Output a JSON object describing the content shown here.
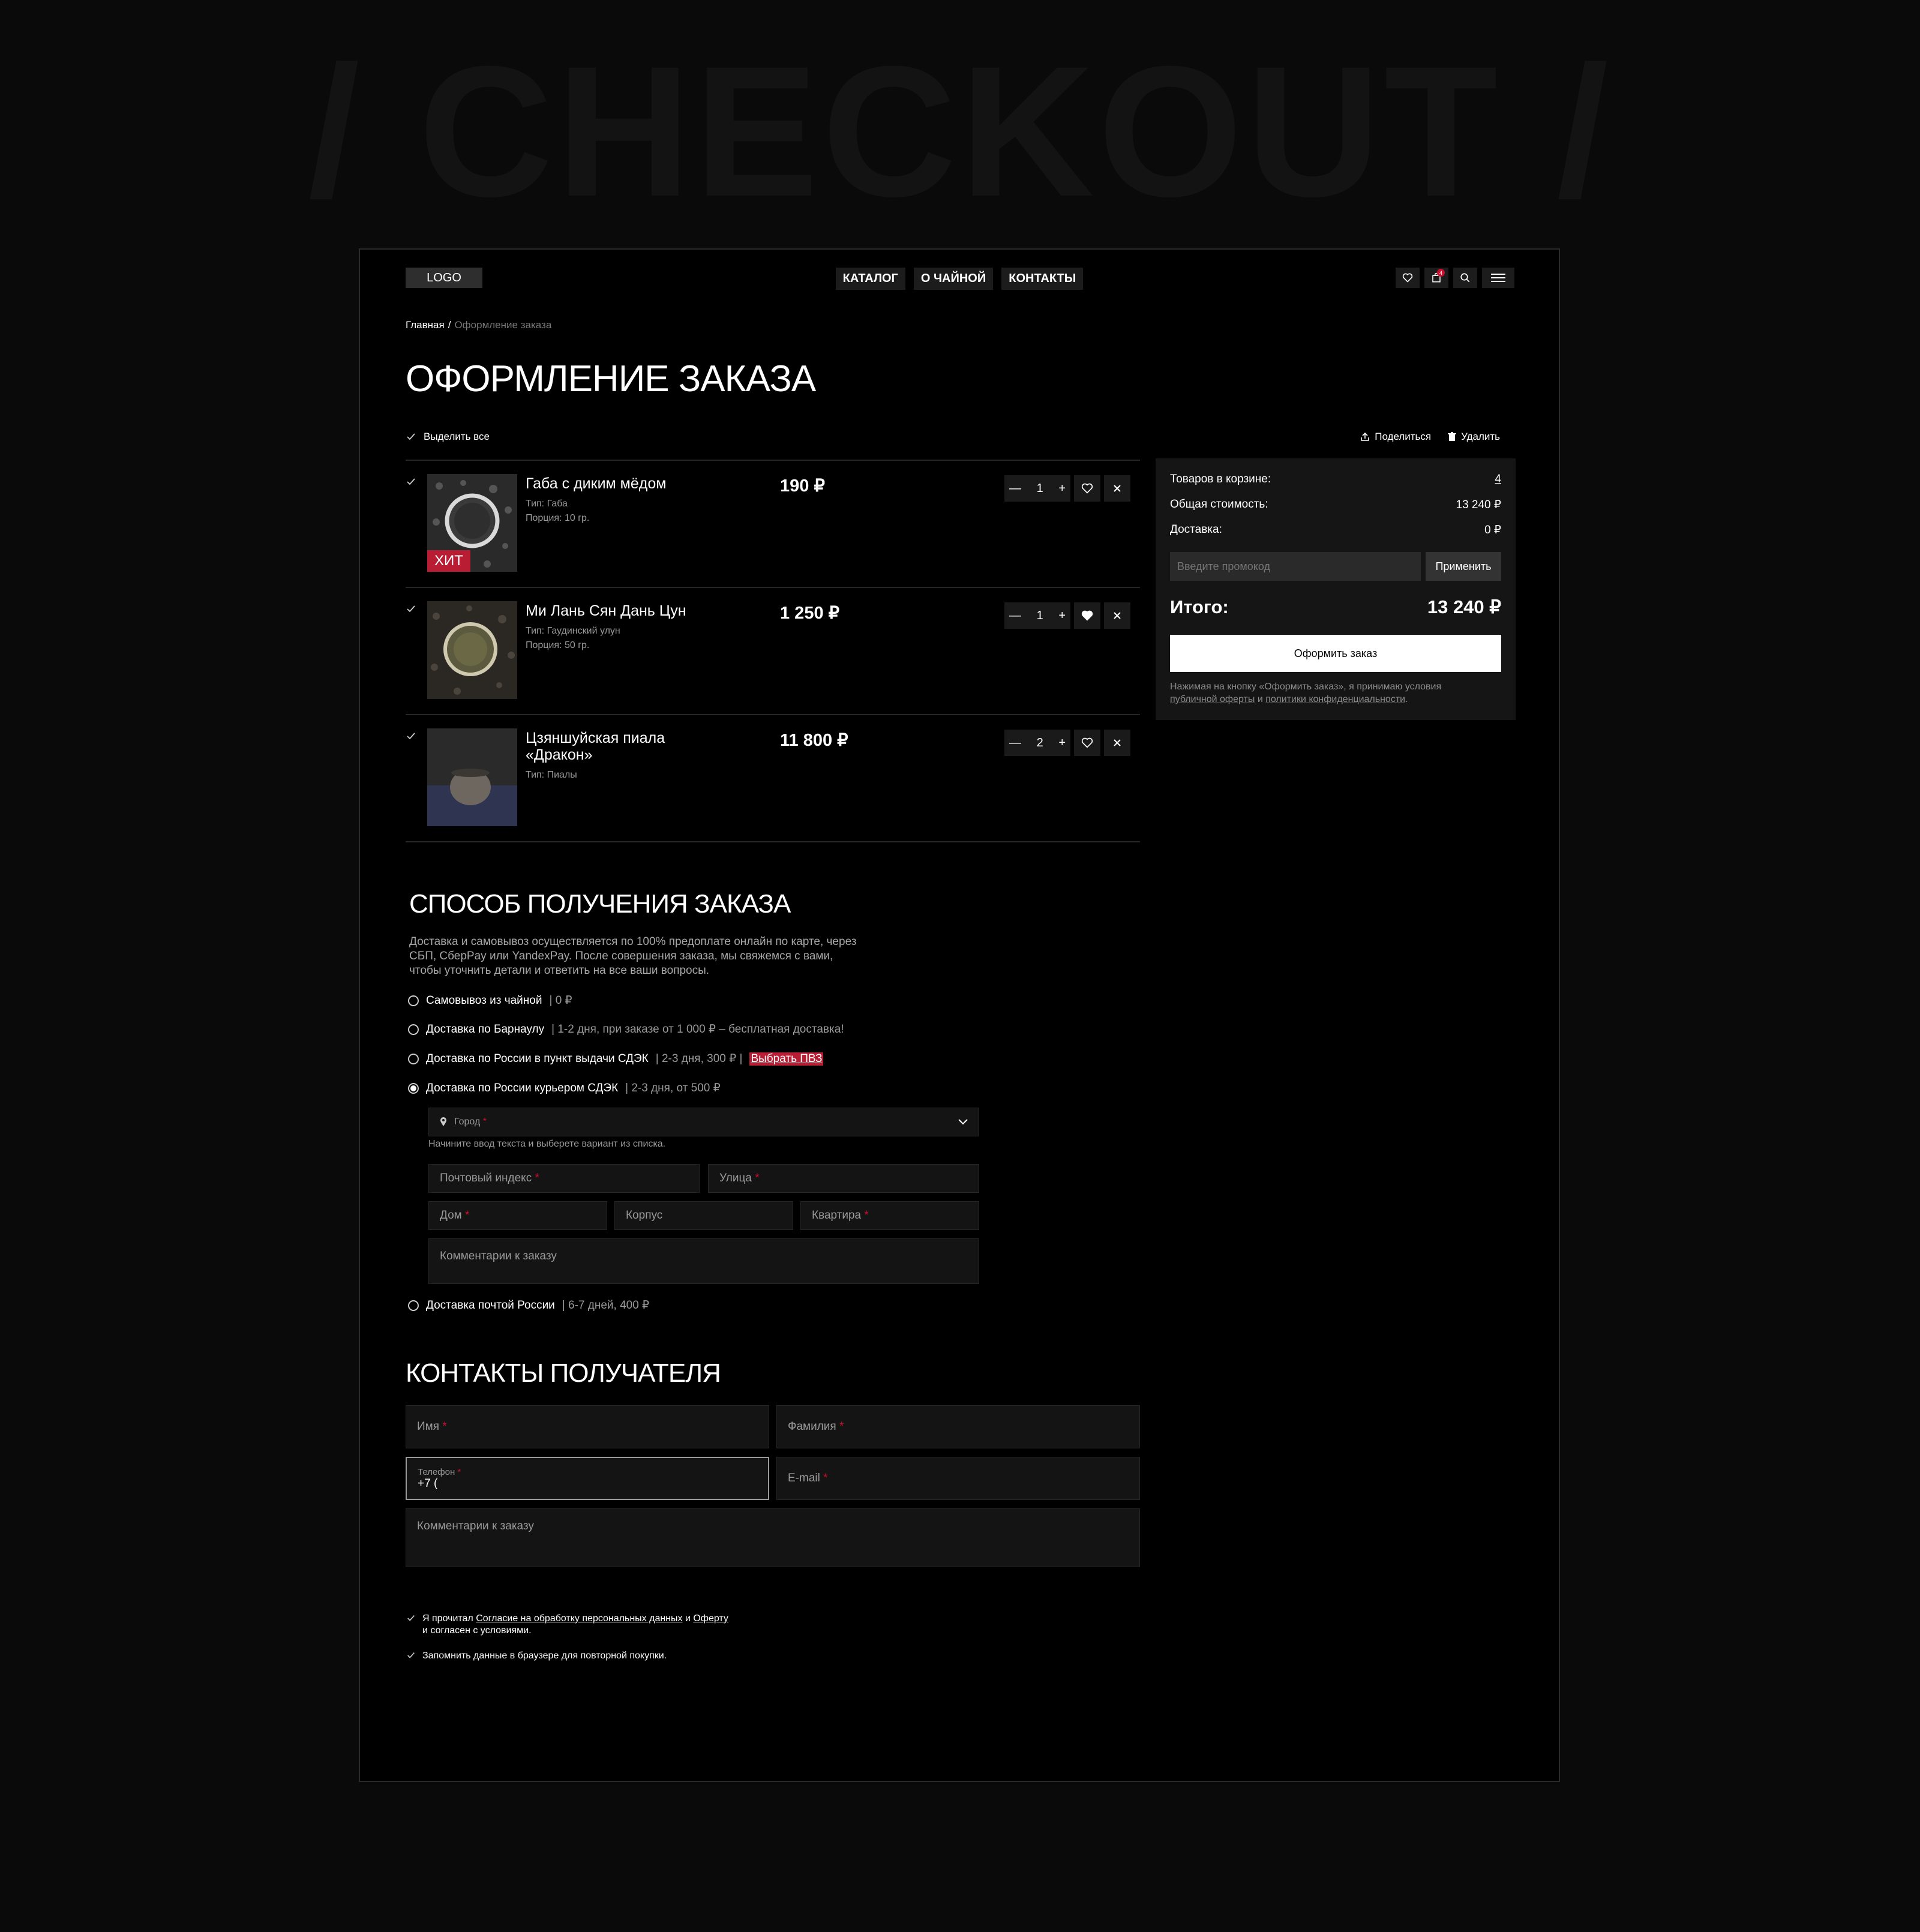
{
  "watermark": "/ CHECKOUT /",
  "header": {
    "logo": "LOGO",
    "nav": [
      "КАТАЛОГ",
      "О ЧАЙНОЙ",
      "КОНТАКТЫ"
    ],
    "cart_count": "4"
  },
  "breadcrumb": {
    "home": "Главная",
    "separator": "/",
    "current": "Оформление заказа"
  },
  "page_title": "ОФОРМЛЕНИЕ ЗАКАЗА",
  "cart_toolbar": {
    "select_all": "Выделить все",
    "share": "Поделиться",
    "delete": "Удалить"
  },
  "items": [
    {
      "name": "Габа с диким мёдом",
      "meta1": "Тип: Габа",
      "meta2": "Порция: 10 гр.",
      "price": "190 ₽",
      "qty": "1",
      "badge": "ХИТ",
      "favorited": false
    },
    {
      "name": "Ми Лань Сян Дань Цун",
      "meta1": "Тип: Гаудинский улун",
      "meta2": "Порция: 50 гр.",
      "price": "1 250 ₽",
      "qty": "1",
      "badge": "",
      "favorited": true
    },
    {
      "name": "Цзяншуйская пиала «Дракон»",
      "meta1": "Тип: Пиалы",
      "meta2": "",
      "price": "11 800 ₽",
      "qty": "2",
      "badge": "",
      "favorited": false
    }
  ],
  "summary": {
    "items_label": "Товаров в корзине:",
    "items_value": "4",
    "cost_label": "Общая стоимость:",
    "cost_value": "13 240 ₽",
    "delivery_label": "Доставка:",
    "delivery_value": "0 ₽",
    "promo_placeholder": "Введите промокод",
    "promo_button": "Применить",
    "total_label": "Итого:",
    "total_value": "13 240 ₽",
    "order_button": "Оформить заказ",
    "legal_1": "Нажимая на кнопку «Оформить заказ», я принимаю условия",
    "legal_link_1": "публичной оферты",
    "legal_and": "и",
    "legal_link_2": "политики конфиденциальности",
    "legal_end": "."
  },
  "delivery": {
    "title": "СПОСОБ ПОЛУЧЕНИЯ ЗАКАЗА",
    "description": "Доставка и самовывоз осуществляется по 100% предоплате онлайн по карте, через СБП, СберPay или YandexPay. После совершения заказа, мы свяжемся с вами, чтобы уточнить детали и ответить на все ваши вопросы.",
    "options": [
      {
        "label": "Самовывоз из чайной",
        "detail": "0 ₽",
        "selected": false
      },
      {
        "label": "Доставка по Барнаулу",
        "detail": "1-2 дня, при заказе от  1 000 ₽ – бесплатная доставка!",
        "selected": false
      },
      {
        "label": "Доставка по России в пункт выдачи СДЭК",
        "detail": "2-3 дня, 300 ₽",
        "link": "Выбрать ПВЗ",
        "selected": false
      },
      {
        "label": "Доставка по России курьером СДЭК",
        "detail": "2-3 дня, от 500 ₽",
        "selected": true
      },
      {
        "label": "Доставка почтой России",
        "detail": "6-7 дней, 400 ₽",
        "selected": false
      }
    ],
    "city_placeholder": "Город",
    "city_hint": "Начините ввод текста и выберете вариант из списка.",
    "postal": "Почтовый индекс",
    "street": "Улица",
    "house": "Дом",
    "building": "Корпус",
    "apartment": "Квартира",
    "comment": "Комментарии к заказу",
    "required_mark": "*"
  },
  "contacts": {
    "title": "КОНТАКТЫ ПОЛУЧАТЕЛЯ",
    "first_name": "Имя",
    "last_name": "Фамилия",
    "phone_label": "Телефон",
    "phone_value": "+7 (",
    "email": "E-mail",
    "comment": "Комментарии к заказу"
  },
  "consents": {
    "c1_a": "Я прочитал",
    "c1_link1": "Согласие на обработку персональных данных",
    "c1_and": "и",
    "c1_link2": "Оферту",
    "c1_b": "и согласен с условиями.",
    "c2": "Запомнить данные в браузере для повторной покупки."
  },
  "colors": {
    "accent": "#b81d33",
    "background": "#000000",
    "panel": "#151515"
  }
}
